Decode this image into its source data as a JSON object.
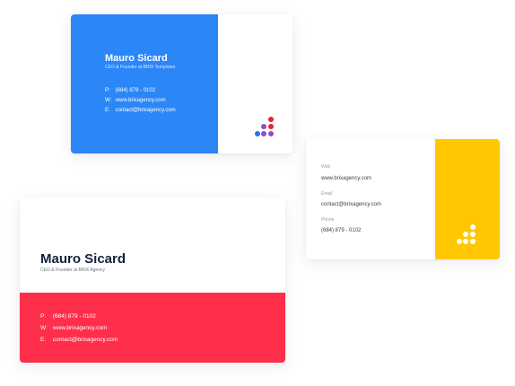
{
  "colors": {
    "blue": "#2b86f8",
    "yellow": "#ffc700",
    "red": "#ff2e4a",
    "dot_red": "#e8213b",
    "dot_purple": "#8e4fc2",
    "dot_blue": "#2b6ff0",
    "white": "#ffffff"
  },
  "card_blue": {
    "name": "Mauro Sicard",
    "role": "CEO & Founder at BRIX Templates",
    "phone_label": "P:",
    "phone": "(684) 879 - 0102",
    "web_label": "W:",
    "web": "www.brixagency.com",
    "email_label": "E:",
    "email": "contact@brixagency.com",
    "logo_icon": "dot-logo-icon"
  },
  "card_yellow": {
    "web_label": "Web",
    "web": "www.brixagency.com",
    "email_label": "Email",
    "email": "contact@brixagency.com",
    "phone_label": "Phone",
    "phone": "(684) 879 - 0102",
    "logo_icon": "dot-logo-icon"
  },
  "card_red": {
    "name": "Mauro Sicard",
    "role": "CEO & Founder at BRIX Agency",
    "phone_label": "P:",
    "phone": "(684) 879 - 0102",
    "web_label": "W:",
    "web": "www.brixagency.com",
    "email_label": "E:",
    "email": "contact@brixagency.com"
  }
}
